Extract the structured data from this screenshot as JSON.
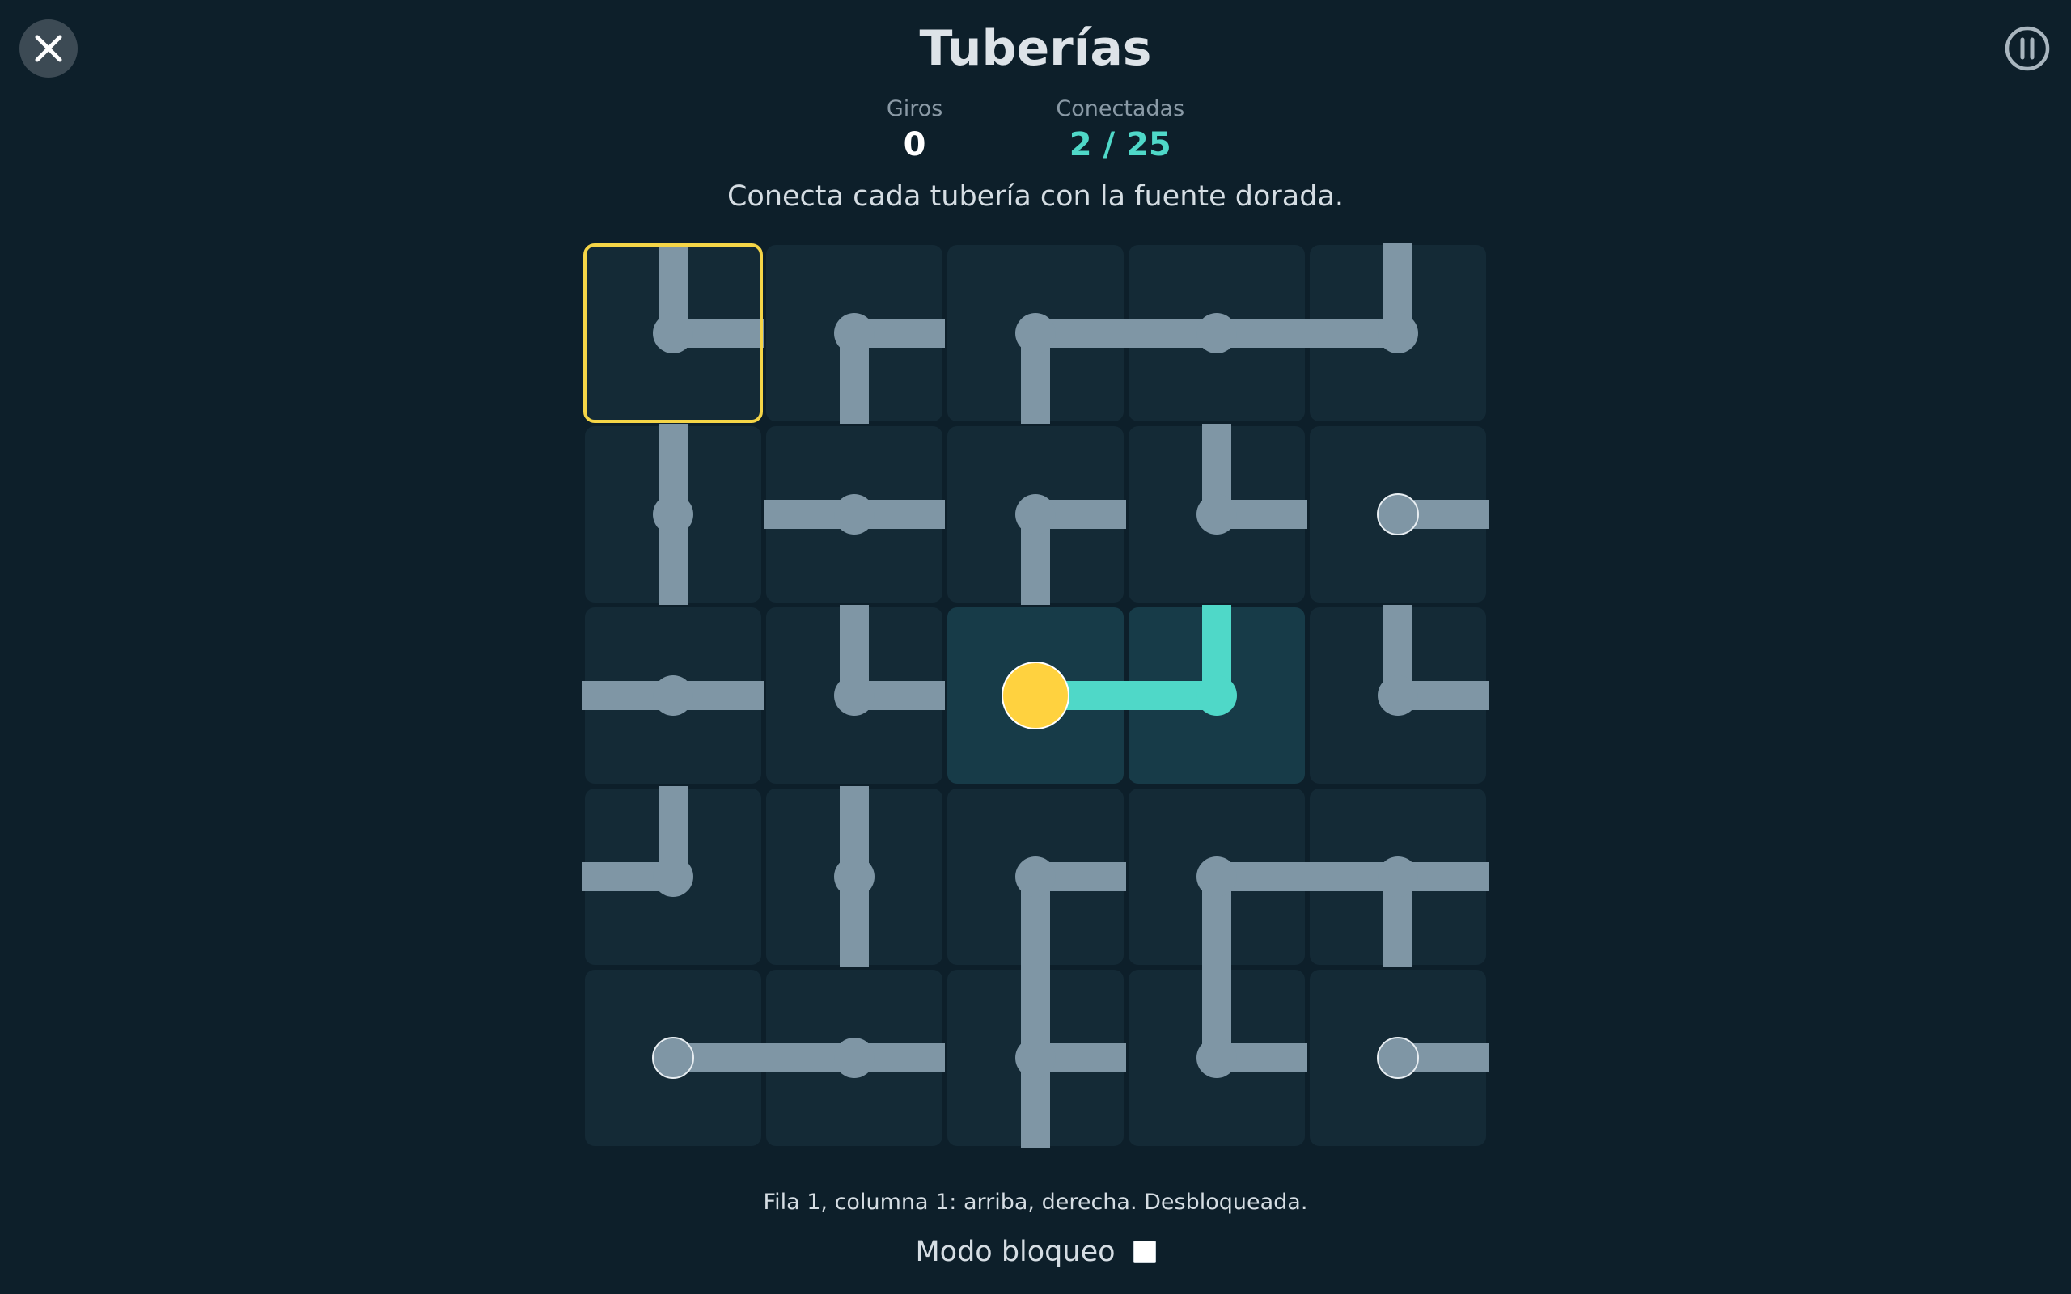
{
  "header": {
    "title": "Tuberías",
    "close_icon": "close-icon",
    "pause_icon": "pause-icon"
  },
  "stats": {
    "turns_label": "Giros",
    "turns_value": "0",
    "connected_label": "Conectadas",
    "connected_value": "2 / 25"
  },
  "instruction": "Conecta cada tubería con la fuente dorada.",
  "board": {
    "rows": 5,
    "cols": 5,
    "selected": [
      0,
      0
    ],
    "tiles": [
      [
        {
          "openings": [
            "up",
            "right"
          ],
          "connected": false
        },
        {
          "openings": [
            "right",
            "down"
          ],
          "connected": false
        },
        {
          "openings": [
            "right",
            "down"
          ],
          "connected": false
        },
        {
          "openings": [
            "left",
            "right"
          ],
          "connected": false
        },
        {
          "openings": [
            "up",
            "left"
          ],
          "connected": false
        }
      ],
      [
        {
          "openings": [
            "up",
            "down"
          ],
          "connected": false
        },
        {
          "openings": [
            "left",
            "right"
          ],
          "connected": false
        },
        {
          "openings": [
            "right",
            "down"
          ],
          "connected": false
        },
        {
          "openings": [
            "up",
            "right"
          ],
          "connected": false
        },
        {
          "openings": [
            "right"
          ],
          "connected": false
        }
      ],
      [
        {
          "openings": [
            "left",
            "right"
          ],
          "connected": false
        },
        {
          "openings": [
            "up",
            "right"
          ],
          "connected": false
        },
        {
          "openings": [
            "right"
          ],
          "connected": true,
          "source": true
        },
        {
          "openings": [
            "up",
            "left"
          ],
          "connected": true
        },
        {
          "openings": [
            "up",
            "right"
          ],
          "connected": false
        }
      ],
      [
        {
          "openings": [
            "up",
            "left"
          ],
          "connected": false
        },
        {
          "openings": [
            "up",
            "down"
          ],
          "connected": false
        },
        {
          "openings": [
            "right",
            "down"
          ],
          "connected": false
        },
        {
          "openings": [
            "right",
            "down"
          ],
          "connected": false
        },
        {
          "openings": [
            "left",
            "right",
            "down"
          ],
          "connected": false
        }
      ],
      [
        {
          "openings": [
            "right"
          ],
          "connected": false
        },
        {
          "openings": [
            "left",
            "right"
          ],
          "connected": false
        },
        {
          "openings": [
            "up",
            "right",
            "down"
          ],
          "connected": false
        },
        {
          "openings": [
            "up",
            "right"
          ],
          "connected": false
        },
        {
          "openings": [
            "right"
          ],
          "connected": false
        }
      ]
    ]
  },
  "status_line": "Fila 1, columna 1: arriba, derecha. Desbloqueada.",
  "lock_mode": {
    "label": "Modo bloqueo",
    "checked": false
  },
  "colors": {
    "background": "#0d1f2a",
    "tile": "#142a36",
    "tile_connected": "#173b48",
    "pipe": "#7f96a5",
    "pipe_connected": "#4fd8c8",
    "source": "#ffd23f",
    "selection": "#f5d547"
  }
}
